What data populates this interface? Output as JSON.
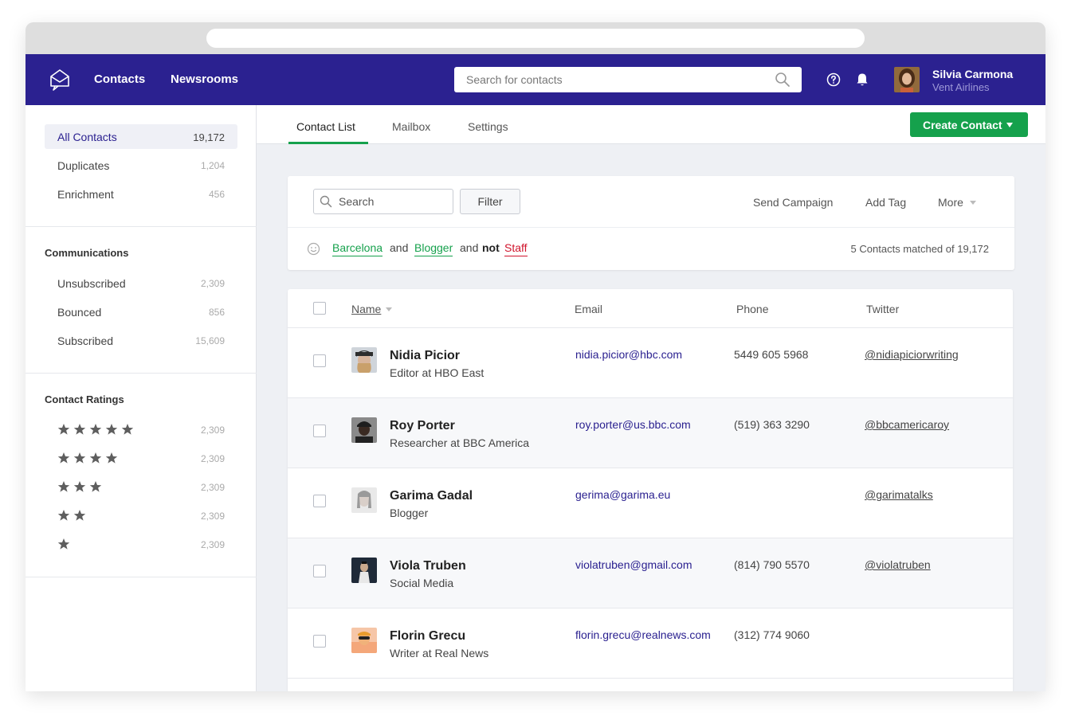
{
  "topnav": {
    "links": [
      "Contacts",
      "Newsrooms"
    ],
    "search_placeholder": "Search for contacts",
    "user": {
      "name": "Silvia Carmona",
      "org": "Vent Airlines"
    }
  },
  "sidebar": {
    "primary": [
      {
        "label": "All Contacts",
        "count": "19,172",
        "active": true
      },
      {
        "label": "Duplicates",
        "count": "1,204"
      },
      {
        "label": "Enrichment",
        "count": "456"
      }
    ],
    "communications": {
      "heading": "Communications",
      "items": [
        {
          "label": "Unsubscribed",
          "count": "2,309"
        },
        {
          "label": "Bounced",
          "count": "856"
        },
        {
          "label": "Subscribed",
          "count": "15,609"
        }
      ]
    },
    "ratings": {
      "heading": "Contact Ratings",
      "items": [
        {
          "stars": 5,
          "count": "2,309"
        },
        {
          "stars": 4,
          "count": "2,309"
        },
        {
          "stars": 3,
          "count": "2,309"
        },
        {
          "stars": 2,
          "count": "2,309"
        },
        {
          "stars": 1,
          "count": "2,309"
        }
      ]
    }
  },
  "tabs": [
    "Contact List",
    "Mailbox",
    "Settings"
  ],
  "create_button": "Create Contact",
  "filter": {
    "search_placeholder": "Search",
    "filter_label": "Filter",
    "actions": [
      "Send Campaign",
      "Add Tag",
      "More"
    ],
    "rules": {
      "tag1": "Barcelona",
      "and1": "and",
      "tag2": "Blogger",
      "and2": "and",
      "not": "not",
      "tag3": "Staff"
    },
    "match_text": "5 Contacts matched of 19,172"
  },
  "table": {
    "headers": {
      "name": "Name",
      "email": "Email",
      "phone": "Phone",
      "twitter": "Twitter"
    },
    "rows": [
      {
        "name": "Nidia Picior",
        "title": "Editor at HBO East",
        "email": "nidia.picior@hbc.com",
        "phone": "5449 605 5968",
        "twitter": "@nidiapiciorwriting"
      },
      {
        "name": "Roy Porter",
        "title": "Researcher at BBC America",
        "email": "roy.porter@us.bbc.com",
        "phone": "(519) 363 3290",
        "twitter": "@bbcamericaroy"
      },
      {
        "name": "Garima Gadal",
        "title": "Blogger",
        "email": "gerima@garima.eu",
        "phone": "",
        "twitter": "@garimatalks"
      },
      {
        "name": "Viola Truben",
        "title": "Social Media",
        "email": "violatruben@gmail.com",
        "phone": "(814) 790 5570",
        "twitter": "@violatruben"
      },
      {
        "name": "Florin Grecu",
        "title": "Writer at Real News",
        "email": "florin.grecu@realnews.com",
        "phone": "(312) 774 9060",
        "twitter": ""
      }
    ]
  },
  "colors": {
    "brand": "#2b2190",
    "accent_green": "#15a14c",
    "negative_red": "#d0142c"
  }
}
